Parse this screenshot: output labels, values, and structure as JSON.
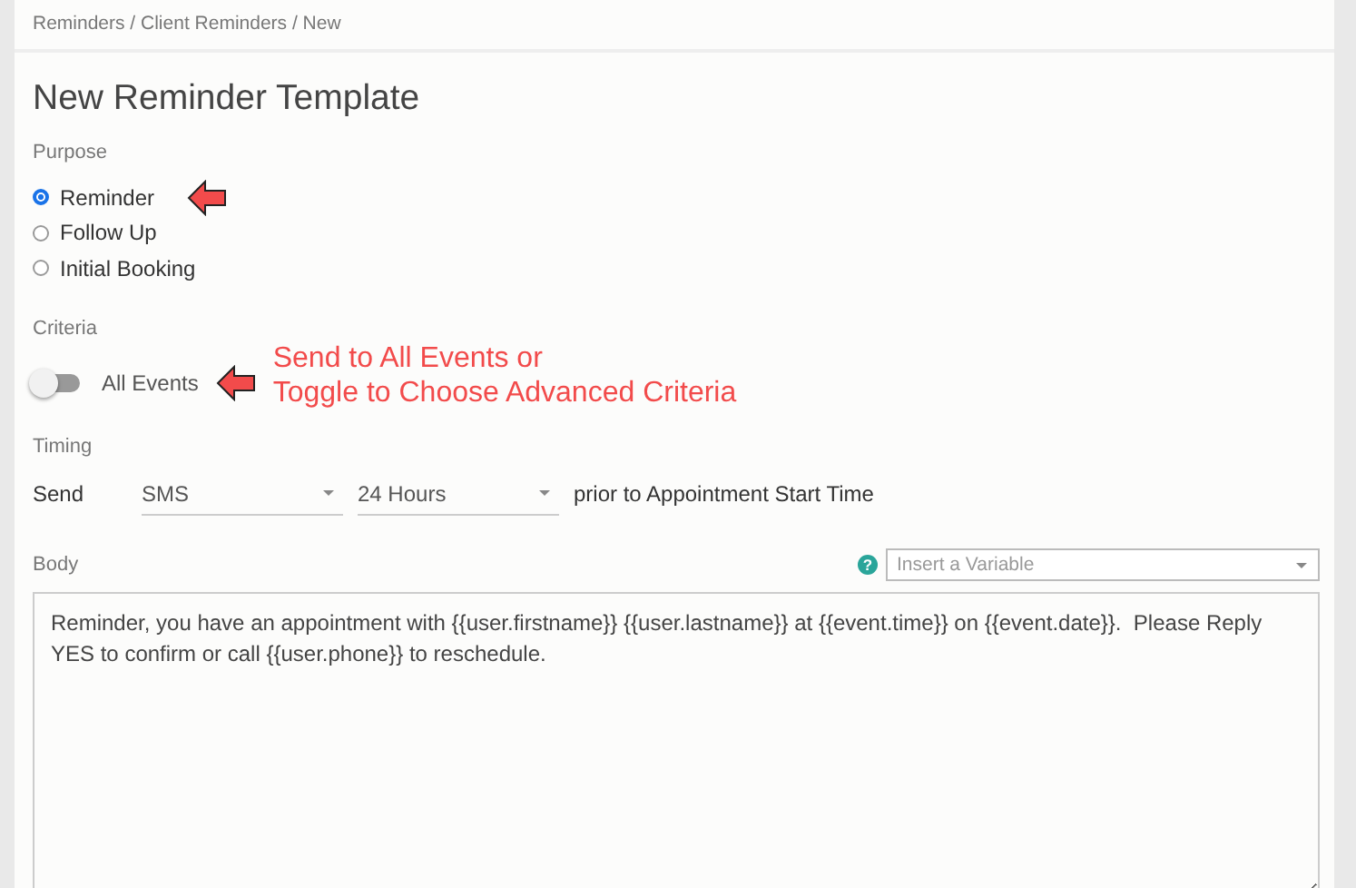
{
  "breadcrumb": "Reminders / Client Reminders / New",
  "title": "New Reminder Template",
  "purpose": {
    "label": "Purpose",
    "options": [
      {
        "label": "Reminder",
        "selected": true,
        "arrow": true
      },
      {
        "label": "Follow Up",
        "selected": false,
        "arrow": false
      },
      {
        "label": "Initial Booking",
        "selected": false,
        "arrow": false
      }
    ]
  },
  "criteria": {
    "label": "Criteria",
    "toggle": {
      "label": "All Events",
      "on": false,
      "arrow": true
    },
    "callout": [
      "Send to All Events or",
      "Toggle to Choose Advanced Criteria"
    ]
  },
  "timing": {
    "label": "Timing",
    "send_label": "Send",
    "channel": "SMS",
    "offset": "24 Hours",
    "suffix": "prior to Appointment Start Time"
  },
  "body": {
    "label": "Body",
    "variable_placeholder": "Insert a Variable",
    "help_icon": "?",
    "text": "Reminder, you have an appointment with {{user.firstname}} {{user.lastname}} at {{event.time}} on {{event.date}}.  Please Reply YES to confirm or call {{user.phone}} to reschedule."
  }
}
